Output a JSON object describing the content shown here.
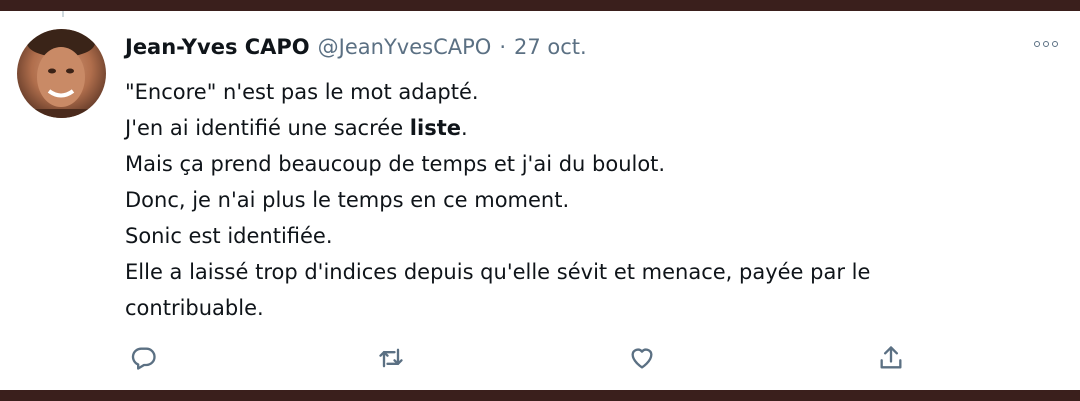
{
  "tweet": {
    "author_name": "Jean-Yves CAPO",
    "handle": "@JeanYvesCAPO",
    "separator": "·",
    "date": "27 oct.",
    "lines": [
      {
        "text": "\"Encore\" n'est pas le mot adapté."
      },
      {
        "prefix": "J'en ai identifié une sacrée ",
        "bold": "liste",
        "suffix": "."
      },
      {
        "text": "Mais ça prend beaucoup de temps et j'ai du boulot."
      },
      {
        "text": "Donc, je n'ai plus le temps en ce moment."
      },
      {
        "text": "Sonic est identifiée."
      },
      {
        "text": "Elle a laissé trop d'indices depuis qu'elle sévit et menace, payée par le"
      },
      {
        "text": "contribuable."
      }
    ]
  },
  "icons": {
    "more": "more-options-icon",
    "reply": "reply-icon",
    "retweet": "retweet-icon",
    "like": "like-icon",
    "share": "share-icon"
  },
  "colors": {
    "frame": "#3a1f1c",
    "text": "#0f1419",
    "secondary": "#5b7083"
  }
}
